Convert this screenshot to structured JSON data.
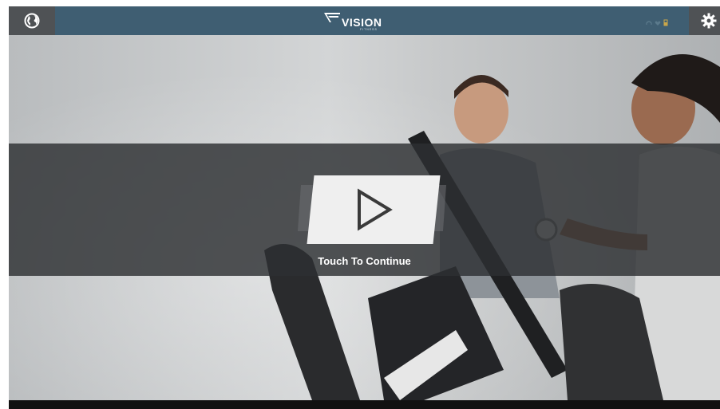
{
  "header": {
    "brand_name": "VISION",
    "brand_sub": "FITNESS",
    "globe_icon": "globe-icon",
    "settings_icon": "gear-icon",
    "status_icons": [
      "headphones-icon",
      "heart-icon",
      "battery-icon"
    ]
  },
  "hero": {
    "image": "people-on-elliptical-trainers-photo"
  },
  "overlay": {
    "play_icon": "play-icon",
    "touch_label": "Touch To Continue"
  },
  "colors": {
    "header_bg": "#3f5e72",
    "side_button_bg": "#4f5255",
    "overlay_bg": "#2d2f32",
    "card_bg": "#efefef"
  }
}
